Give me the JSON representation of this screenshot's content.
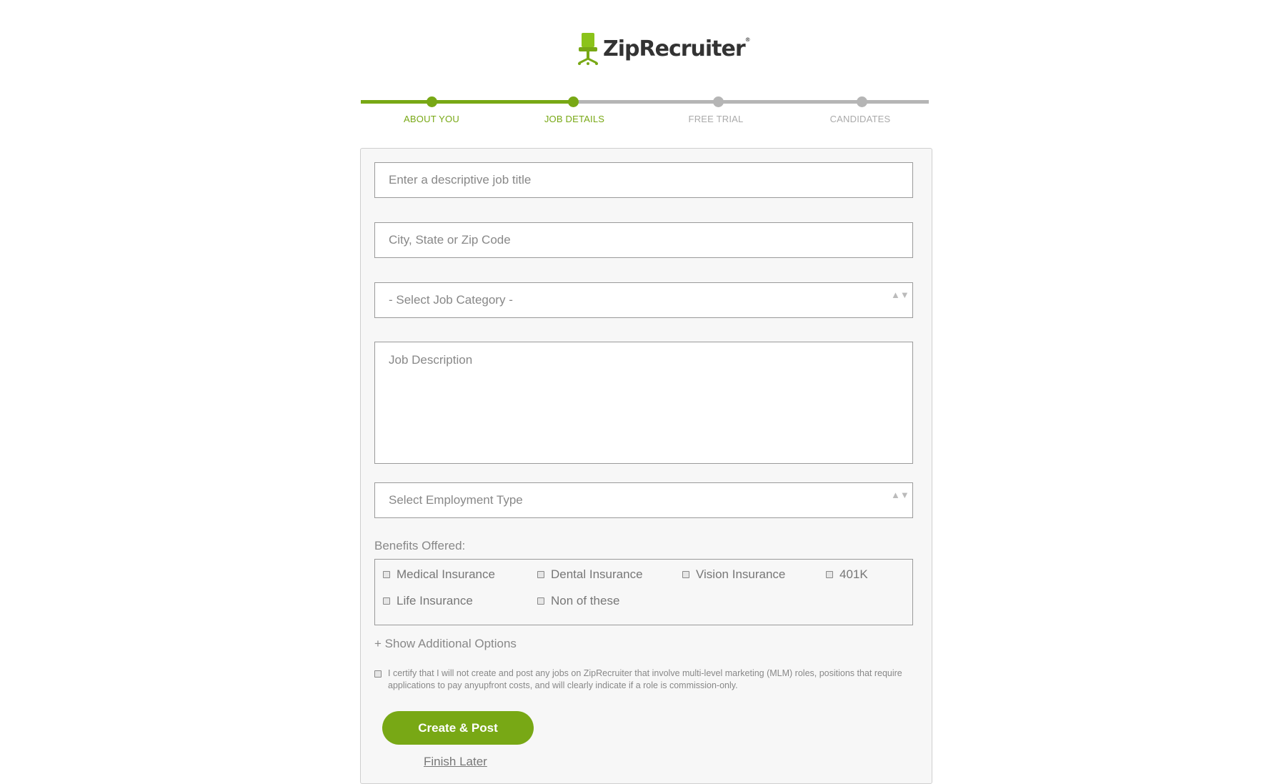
{
  "brand": {
    "name": "ZipRecruiter",
    "registered": "®",
    "accent": "#78a815",
    "icon": "office-chair-icon"
  },
  "progress": {
    "steps": [
      "ABOUT YOU",
      "JOB DETAILS",
      "FREE TRIAL",
      "CANDIDATES"
    ],
    "current_step": 2
  },
  "form": {
    "job_title_placeholder": "Enter a descriptive job title",
    "location_placeholder": "City, State or Zip Code",
    "category_selected": "- Select Job Category -",
    "description_placeholder": "Job Description",
    "employment_type_selected": "Select Employment Type",
    "select_arrows": "▲▼",
    "benefits_label": "Benefits Offered:",
    "benefits": [
      "Medical Insurance",
      "Dental Insurance",
      "Vision Insurance",
      "401K",
      "Life Insurance",
      "Non of these"
    ],
    "more_options": "+ Show Additional Options",
    "certify_text": "I certify that I will not create and post any jobs on ZipRecruiter that involve multi-level marketing (MLM) roles, positions that require applications to pay anyupfront costs, and will clearly indicate if a role is commission-only.",
    "submit_label": "Create & Post",
    "finish_later_label": "Finish Later"
  }
}
